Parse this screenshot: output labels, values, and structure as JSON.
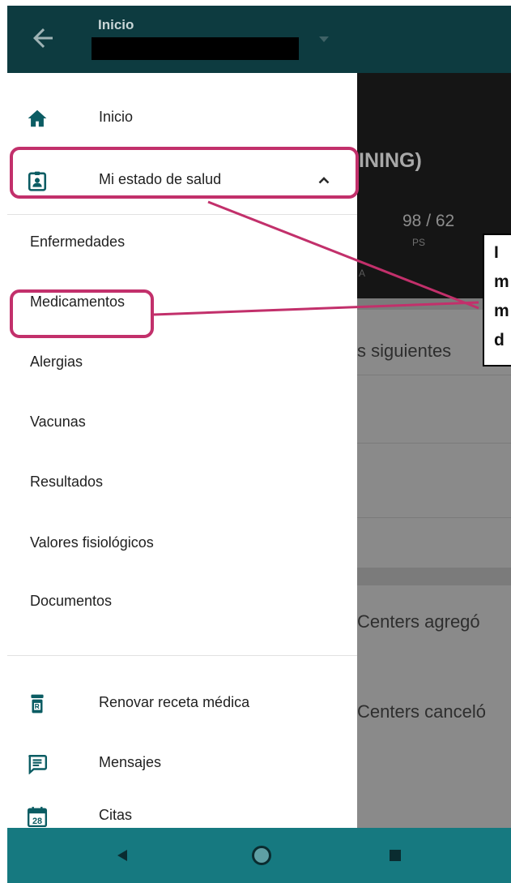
{
  "app_bar": {
    "title": "Inicio"
  },
  "background": {
    "heading": "INING)",
    "stat_value": "98 / 62",
    "stat_label": "PS",
    "mark": "A",
    "line1": "s siguientes",
    "line2": "Centers agregó",
    "line3": "Centers canceló"
  },
  "drawer": {
    "home": {
      "label": "Inicio",
      "icon": "home-icon"
    },
    "health": {
      "label": "Mi estado de salud",
      "icon": "clipboard-id-icon",
      "expanded": true
    },
    "sub_items": [
      {
        "label": "Enfermedades"
      },
      {
        "label": "Medicamentos"
      },
      {
        "label": "Alergias"
      },
      {
        "label": "Vacunas"
      },
      {
        "label": "Resultados"
      },
      {
        "label": "Valores fisiológicos"
      },
      {
        "label": "Documentos"
      }
    ],
    "renew": {
      "label": "Renovar receta médica",
      "icon": "prescription-bottle-icon"
    },
    "messages": {
      "label": "Mensajes",
      "icon": "message-icon"
    },
    "appointments": {
      "label": "Citas",
      "icon": "calendar-icon",
      "day": "28"
    }
  },
  "callout": {
    "lines": [
      "I",
      "m",
      "m",
      "d"
    ]
  },
  "colors": {
    "app_bar": "#0d3b40",
    "accent": "#0b5c63",
    "nav_bar": "#167980",
    "highlight": "#c2306b"
  }
}
